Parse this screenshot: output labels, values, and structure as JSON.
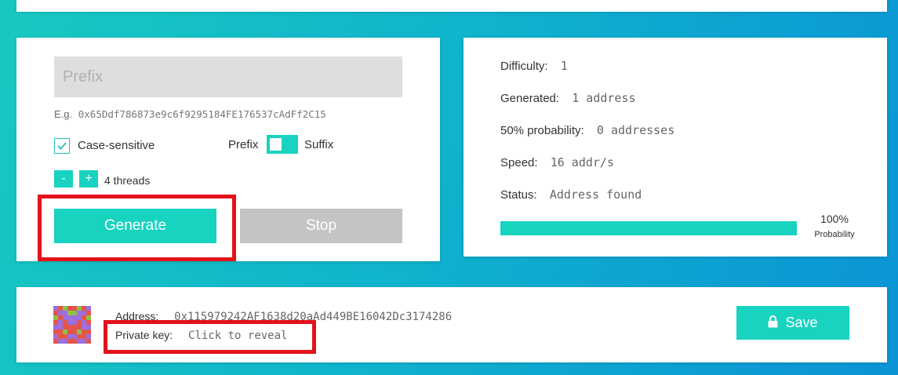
{
  "generator": {
    "prefix_placeholder": "Prefix",
    "prefix_value": "",
    "example_label": "E.g.",
    "example_value": "0x65Ddf786873e9c6f9295184FE176537cAdFf2C15",
    "case_sensitive_label": "Case-sensitive",
    "case_sensitive_checked": true,
    "mode_prefix_label": "Prefix",
    "mode_suffix_label": "Suffix",
    "threads_minus_label": "-",
    "threads_plus_label": "+",
    "threads_label": "4 threads",
    "generate_label": "Generate",
    "stop_label": "Stop"
  },
  "stats": {
    "difficulty_label": "Difficulty:",
    "difficulty_value": "1",
    "generated_label": "Generated:",
    "generated_value": "1 address",
    "probability50_label": "50% probability:",
    "probability50_value": "0 addresses",
    "speed_label": "Speed:",
    "speed_value": "16 addr/s",
    "status_label": "Status:",
    "status_value": "Address found",
    "probability_percent": "100%",
    "probability_fraction": 1.0,
    "probability_label": "Probability"
  },
  "result": {
    "address_label": "Address:",
    "address_value": "0x115979242AF1638d20aAd449BE16042Dc3174286",
    "private_key_label": "Private key:",
    "private_key_value": "Click to reveal",
    "save_label": "Save"
  },
  "colors": {
    "accent": "#17d3bf",
    "disabled": "#c4c4c4",
    "highlight": "#e3121b"
  },
  "icons": {
    "checkbox": "check-icon",
    "save": "lock-icon",
    "avatar": "identicon"
  }
}
